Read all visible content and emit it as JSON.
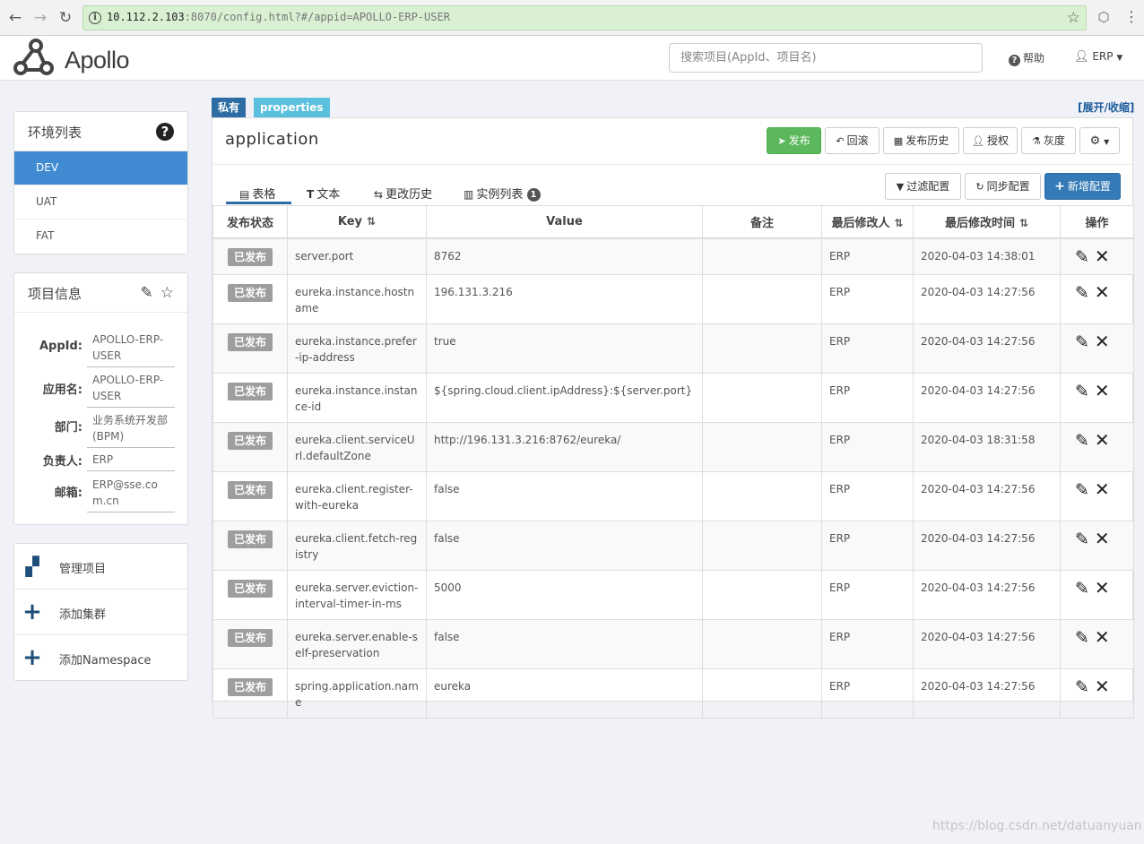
{
  "browser": {
    "url_host": "10.112.2.103",
    "url_path": ":8070/config.html?#/appid=APOLLO-ERP-USER"
  },
  "header": {
    "logo_text": "Apollo",
    "search_placeholder": "搜索项目(AppId、项目名)",
    "help_label": "帮助",
    "user_label": "ERP"
  },
  "env_panel": {
    "title": "环境列表",
    "items": [
      {
        "label": "DEV",
        "active": true
      },
      {
        "label": "UAT",
        "active": false
      },
      {
        "label": "FAT",
        "active": false
      }
    ]
  },
  "info_panel": {
    "title": "项目信息",
    "rows": [
      {
        "label": "AppId:",
        "value": "APOLLO-ERP-USER"
      },
      {
        "label": "应用名:",
        "value": "APOLLO-ERP-USER"
      },
      {
        "label": "部门:",
        "value": "业务系统开发部(BPM)"
      },
      {
        "label": "负责人:",
        "value": "ERP"
      },
      {
        "label": "邮箱:",
        "value": "ERP@sse.com.cn"
      }
    ]
  },
  "actions": [
    {
      "label": "管理项目"
    },
    {
      "label": "添加集群"
    },
    {
      "label": "添加Namespace"
    }
  ],
  "namespace": {
    "tag_private": "私有",
    "tag_format": "properties",
    "expand_label": "[展开/收缩]",
    "name": "application",
    "buttons": {
      "publish": "发布",
      "rollback": "回滚",
      "history": "发布历史",
      "grant": "授权",
      "gray": "灰度"
    },
    "tabs": {
      "table": "表格",
      "text": "文本",
      "change_history": "更改历史",
      "instances": "实例列表",
      "instances_count": "1"
    },
    "tool_buttons": {
      "filter": "过滤配置",
      "sync": "同步配置",
      "add": "新增配置"
    },
    "columns": {
      "status": "发布状态",
      "key": "Key",
      "value": "Value",
      "comment": "备注",
      "modifier": "最后修改人",
      "modified_time": "最后修改时间",
      "ops": "操作"
    },
    "rows": [
      {
        "status": "已发布",
        "key": "server.port",
        "value": "8762",
        "comment": "",
        "modifier": "ERP",
        "time": "2020-04-03 14:38:01"
      },
      {
        "status": "已发布",
        "key": "eureka.instance.hostname",
        "value": "196.131.3.216",
        "comment": "",
        "modifier": "ERP",
        "time": "2020-04-03 14:27:56"
      },
      {
        "status": "已发布",
        "key": "eureka.instance.prefer-ip-address",
        "value": "true",
        "comment": "",
        "modifier": "ERP",
        "time": "2020-04-03 14:27:56"
      },
      {
        "status": "已发布",
        "key": "eureka.instance.instance-id",
        "value": "${spring.cloud.client.ipAddress}:${server.port}",
        "comment": "",
        "modifier": "ERP",
        "time": "2020-04-03 14:27:56"
      },
      {
        "status": "已发布",
        "key": "eureka.client.serviceUrl.defaultZone",
        "value": "http://196.131.3.216:8762/eureka/",
        "comment": "",
        "modifier": "ERP",
        "time": "2020-04-03 18:31:58"
      },
      {
        "status": "已发布",
        "key": "eureka.client.register-with-eureka",
        "value": "false",
        "comment": "",
        "modifier": "ERP",
        "time": "2020-04-03 14:27:56"
      },
      {
        "status": "已发布",
        "key": "eureka.client.fetch-registry",
        "value": "false",
        "comment": "",
        "modifier": "ERP",
        "time": "2020-04-03 14:27:56"
      },
      {
        "status": "已发布",
        "key": "eureka.server.eviction-interval-timer-in-ms",
        "value": "5000",
        "comment": "",
        "modifier": "ERP",
        "time": "2020-04-03 14:27:56"
      },
      {
        "status": "已发布",
        "key": "eureka.server.enable-self-preservation",
        "value": "false",
        "comment": "",
        "modifier": "ERP",
        "time": "2020-04-03 14:27:56"
      },
      {
        "status": "已发布",
        "key": "spring.application.name",
        "value": "eureka",
        "comment": "",
        "modifier": "ERP",
        "time": "2020-04-03 14:27:56"
      }
    ]
  },
  "watermark": "https://blog.csdn.net/datuanyuan"
}
